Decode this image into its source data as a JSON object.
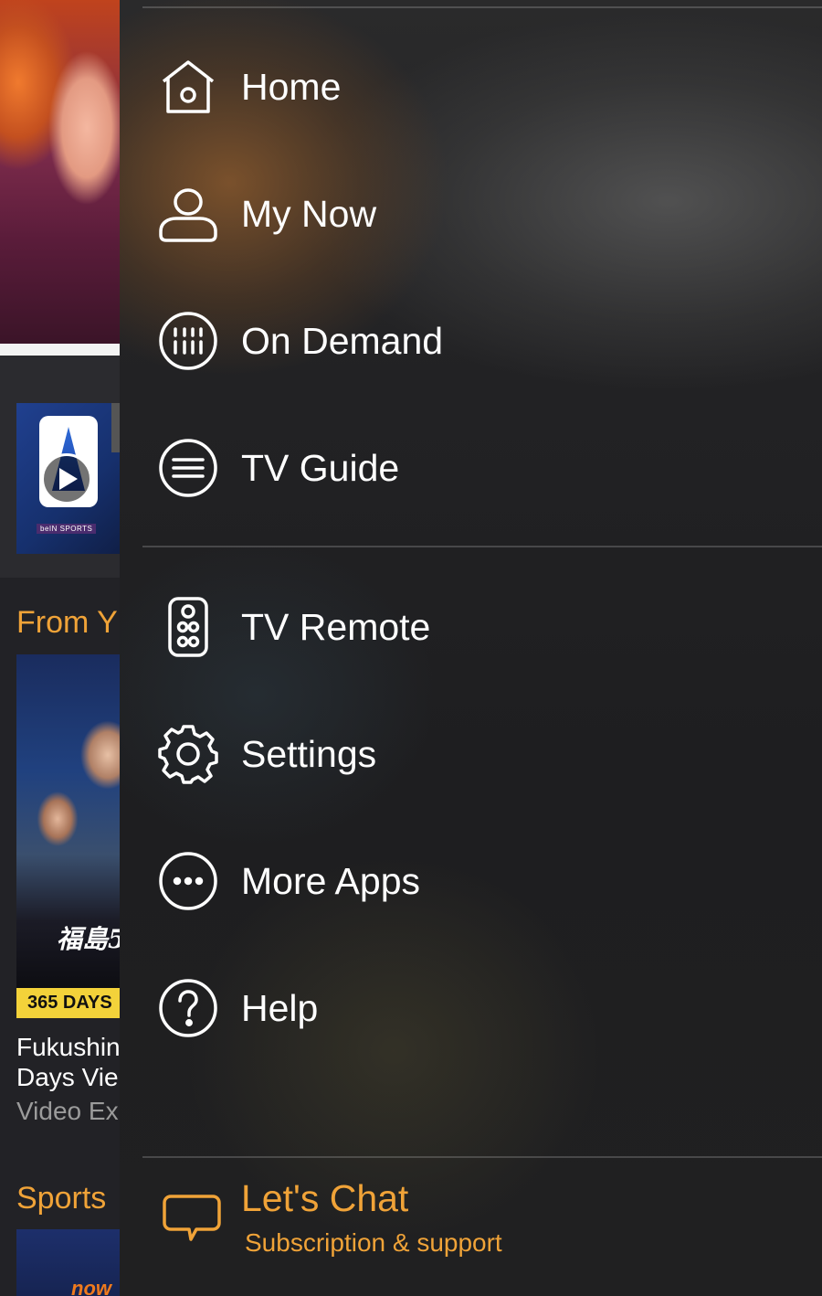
{
  "background": {
    "promo_badge": "beIN SPORTS",
    "section_from_you": "From Y",
    "poster_title_kanji": "福島5",
    "badge_365": "365 DAYS",
    "item_title_line1": "Fukushin",
    "item_title_line2": "Days Vie",
    "item_subtitle": "Video Exp",
    "section_sports": "Sports",
    "now_logo": "now"
  },
  "menu": {
    "items": [
      {
        "label": "Home",
        "icon": "home-icon"
      },
      {
        "label": "My Now",
        "icon": "user-icon"
      },
      {
        "label": "On Demand",
        "icon": "on-demand-icon"
      },
      {
        "label": "TV Guide",
        "icon": "tv-guide-icon"
      },
      {
        "label": "TV Remote",
        "icon": "remote-icon"
      },
      {
        "label": "Settings",
        "icon": "gear-icon"
      },
      {
        "label": "More Apps",
        "icon": "more-icon"
      },
      {
        "label": "Help",
        "icon": "help-icon"
      }
    ],
    "chat": {
      "title": "Let's Chat",
      "subtitle": "Subscription & support",
      "icon": "chat-bubble-icon"
    }
  },
  "colors": {
    "accent": "#f0a338",
    "text": "#ffffff",
    "badge_yellow": "#f3d23a"
  }
}
